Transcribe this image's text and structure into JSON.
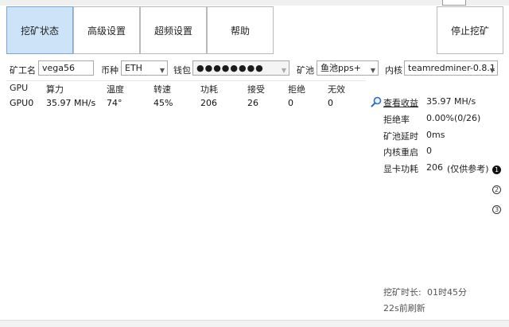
{
  "toolbar": {
    "status_label": "挖矿状态",
    "advanced_label": "高级设置",
    "overclock_label": "超频设置",
    "help_label": "帮助",
    "stop_label": "停止挖矿"
  },
  "filters": {
    "worker_label": "矿工名",
    "worker_value": "vega56",
    "coin_label": "币种",
    "coin_value": "ETH",
    "wallet_label": "钱包",
    "wallet_value": "●●●●●●●●",
    "pool_label": "矿池",
    "pool_value": "鱼池pps+",
    "kernel_label": "内核",
    "kernel_value": "teamredminer-0.8.1"
  },
  "table": {
    "headers": [
      "GPU",
      "算力",
      "温度",
      "转速",
      "功耗",
      "接受",
      "拒绝",
      "无效"
    ],
    "rows": [
      [
        "GPU0",
        "35.97 MH/s",
        "74°",
        "45%",
        "206",
        "26",
        "0",
        "0"
      ]
    ]
  },
  "stats": {
    "view_earnings_label": "查看收益",
    "hashrate_value": "35.97 MH/s",
    "reject_rate_label": "拒绝率",
    "reject_rate_value": "0.00%(0/26)",
    "pool_latency_label": "矿池延时",
    "pool_latency_value": "0ms",
    "kernel_restart_label": "内核重启",
    "kernel_restart_value": "0",
    "card_power_label": "显卡功耗",
    "card_power_value": "206",
    "card_power_note": "(仅供参考)"
  },
  "pagination": [
    "1",
    "2",
    "3"
  ],
  "footer": {
    "mining_time_label": "挖矿时长:",
    "mining_time_value": "01时45分",
    "updated": "22s前刷新"
  },
  "colors": {
    "accent": "#cde3f7",
    "link": "#1f5fbf",
    "note": "#8a7b00"
  }
}
